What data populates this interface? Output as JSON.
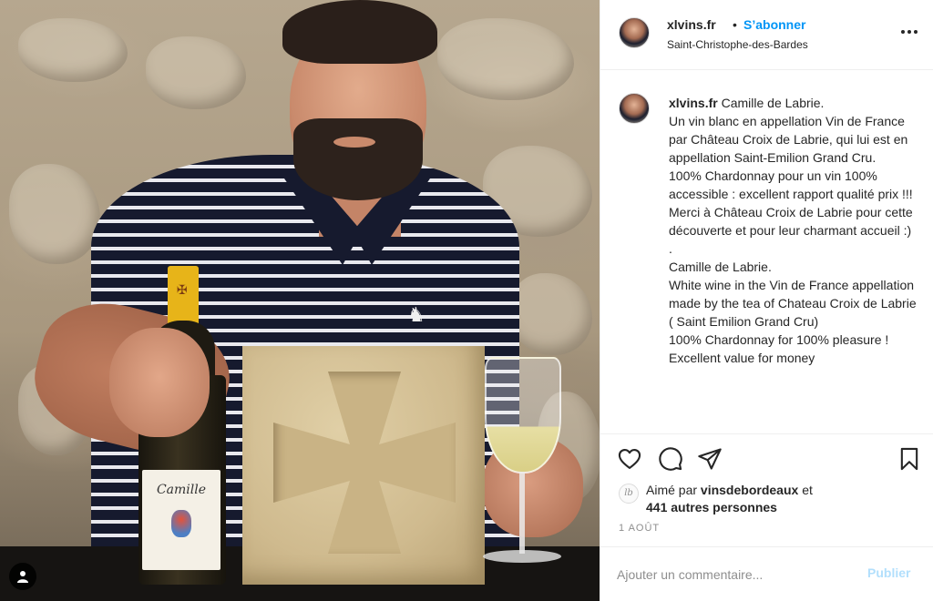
{
  "post": {
    "username": "xlvins.fr",
    "separator": "•",
    "follow_label": "S’abonner",
    "location": "Saint-Christophe-des-Bardes"
  },
  "caption": {
    "username": "xlvins.fr",
    "lines": [
      "Camille de Labrie.",
      "Un vin blanc en appellation Vin de France par Château Croix de Labrie, qui lui est en appellation Saint-Emilion Grand Cru.",
      "100% Chardonnay pour un vin 100% accessible : excellent rapport qualité prix !!!",
      "Merci à Château Croix de Labrie pour cette découverte et pour leur charmant accueil :)",
      ".",
      "Camille de Labrie.",
      "White wine in the Vin de France appellation made by the tea of Chateau Croix de Labrie ( Saint Emilion Grand Cru)",
      "100% Chardonnay for 100% pleasure ! Excellent value for money"
    ]
  },
  "likes": {
    "prefix": "Aimé par",
    "liker": "vinsdebordeaux",
    "suffix": "et",
    "others": "441 autres personnes",
    "avatar_glyph": "lb"
  },
  "date": "1 AOÛT",
  "comment": {
    "placeholder": "Ajouter un commentaire...",
    "post_label": "Publier"
  },
  "photo": {
    "bottle_label": "Camille"
  },
  "colors": {
    "accent": "#0095f6",
    "post_disabled": "#b2dffc",
    "text": "#262626",
    "muted": "#8e8e8e",
    "divider": "#efefef"
  },
  "icons": {
    "like": "heart-icon",
    "comment": "comment-bubble-icon",
    "share": "paper-plane-icon",
    "save": "bookmark-icon",
    "more": "more-options-icon",
    "tag": "user-tag-icon"
  }
}
